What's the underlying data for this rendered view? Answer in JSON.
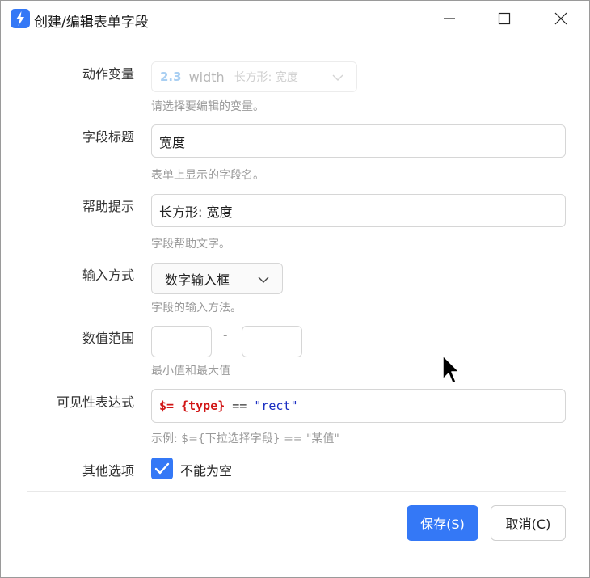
{
  "window": {
    "title": "创建/编辑表单字段",
    "icon": "bolt-icon",
    "controls": [
      "minimize-icon",
      "maximize-icon",
      "close-icon"
    ]
  },
  "form": {
    "action_variable": {
      "label": "动作变量",
      "badge": "2.3",
      "name": "width",
      "type": "长方形: 宽度",
      "hint": "请选择要编辑的变量。"
    },
    "field_title": {
      "label": "字段标题",
      "value": "宽度",
      "hint": "表单上显示的字段名。"
    },
    "help_text": {
      "label": "帮助提示",
      "value": "长方形: 宽度",
      "hint": "字段帮助文字。"
    },
    "input_method": {
      "label": "输入方式",
      "value": "数字输入框",
      "hint": "字段的输入方法。"
    },
    "value_range": {
      "label": "数值范围",
      "min": "",
      "max": "",
      "separator": "-",
      "hint": "最小值和最大值"
    },
    "visibility": {
      "label": "可见性表达式",
      "token_var": "$= {type}",
      "token_op": "==",
      "token_str": "\"rect\"",
      "hint": "示例: $={下拉选择字段} == \"某值\""
    },
    "other": {
      "label": "其他选项",
      "required_label": "不能为空",
      "required_checked": true
    }
  },
  "buttons": {
    "save": "保存(S)",
    "cancel": "取消(C)"
  },
  "colors": {
    "accent": "#3478f6",
    "code_var": "#d11616",
    "code_string": "#1a2ec2"
  }
}
